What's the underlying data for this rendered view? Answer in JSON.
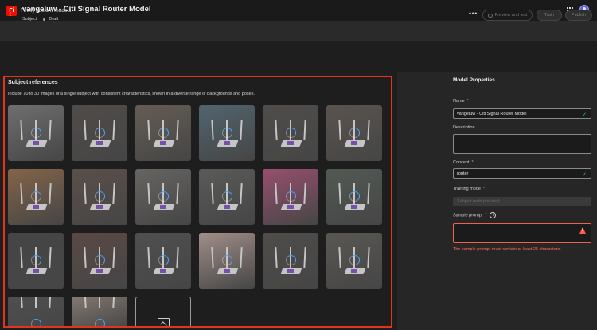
{
  "app": {
    "logo_text": "Fi",
    "title": "Firefly custom models"
  },
  "header": {
    "back_icon": "chevron-left-icon",
    "model_title": "vangeluw - Citi Signal Router Model",
    "type": "Subject",
    "status": "Draft",
    "more_icon": "more-icon",
    "preview_label": "Preview and test",
    "train_label": "Train",
    "publish_label": "Publish"
  },
  "references": {
    "title": "Subject references",
    "description": "Include 10 to 30 images of a single subject with consistent characteristics, shown in a diverse range of backgrounds and poses.",
    "thumbnail_count": 20,
    "thumb_colors": [
      "#6a6a6a",
      "#3a3430",
      "#5a4e40",
      "#3c5a68",
      "#3a3632",
      "#4a4038",
      "#8a5a30",
      "#4a3a30",
      "#5e5a56",
      "#4a4a48",
      "#a83a6a",
      "#3e4a40",
      "#2a2a2a",
      "#4a3028",
      "#3a3a3a",
      "#b89a90",
      "#3a3632",
      "#4a4640",
      "#3a3a3a",
      "#8a7a6a"
    ],
    "add_icon": "add-image-icon"
  },
  "properties": {
    "title": "Model Properties",
    "name_label": "Name",
    "name_value": "vangeluw - Citi Signal Router Model",
    "description_label": "Description",
    "description_value": "",
    "concept_label": "Concept",
    "concept_value": "router",
    "training_mode_label": "Training mode",
    "training_mode_value": "Subject (with preview)",
    "sample_prompt_label": "Sample prompt",
    "sample_prompt_value": "",
    "error": "The sample prompt must contain at least 25 characters.",
    "required_mark": "*",
    "info_glyph": "i"
  },
  "colors": {
    "accent_error": "#e2361c",
    "valid": "#4cd080"
  }
}
